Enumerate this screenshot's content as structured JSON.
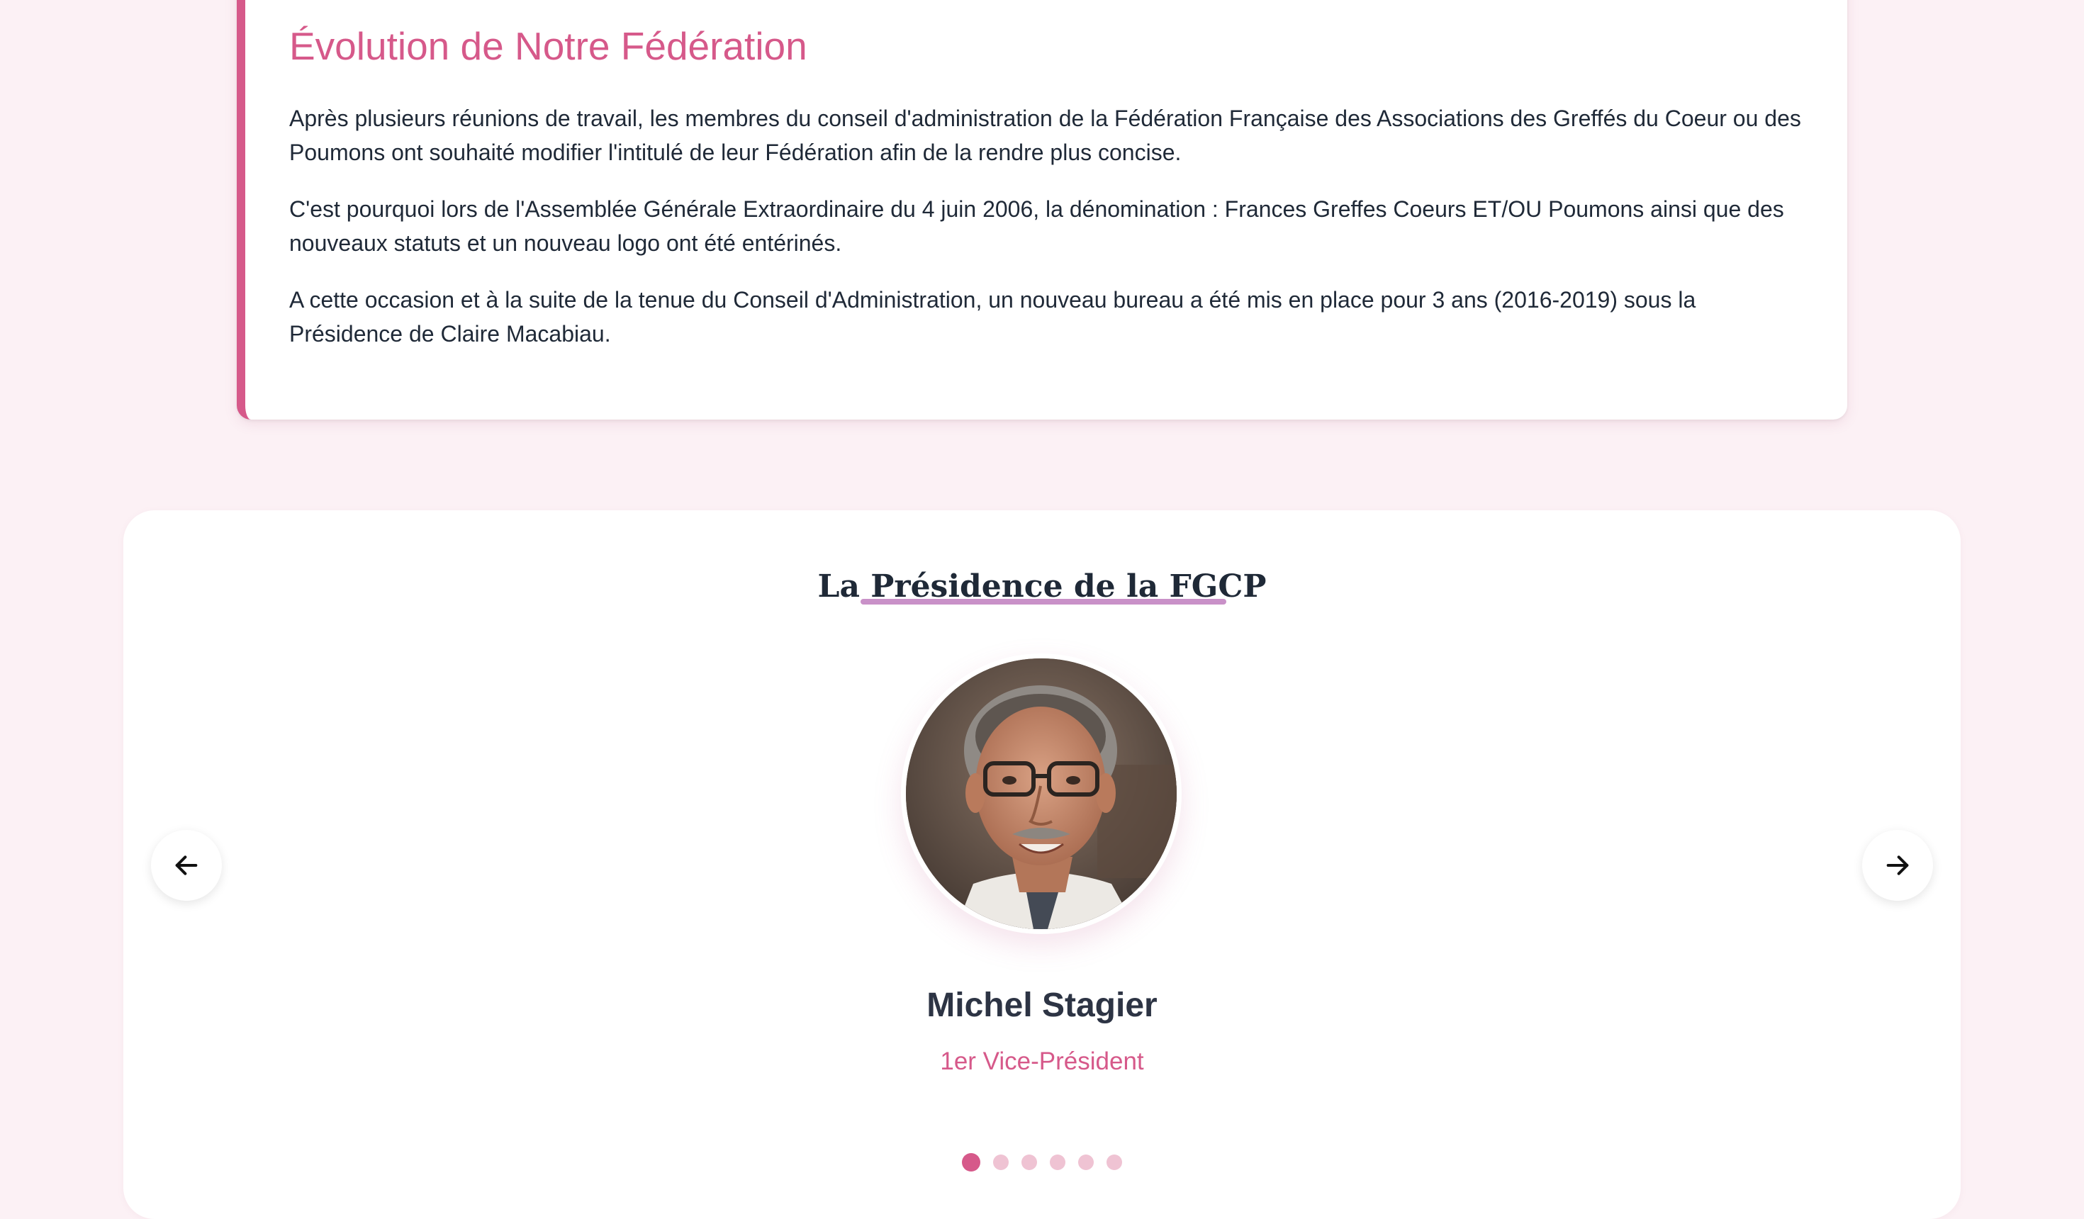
{
  "evolution": {
    "title": "Évolution de Notre Fédération",
    "paragraphs": [
      "Après plusieurs réunions de travail, les membres du conseil d'administration de la Fédération Française des Associations des Greffés du Coeur ou des Poumons ont souhaité modifier l'intitulé de leur Fédération afin de la rendre plus concise.",
      "C'est pourquoi lors de l'Assemblée Générale Extraordinaire du 4 juin 2006, la dénomination : Frances Greffes Coeurs ET/OU Poumons ainsi que des nouveaux statuts et un nouveau logo ont été entérinés.",
      "A cette occasion et à la suite de la tenue du Conseil d'Administration, un nouveau bureau a été mis en place pour 3 ans (2016-2019) sous la Présidence de Claire Macabiau."
    ]
  },
  "presidency": {
    "title": "La Présidence de la FGCP",
    "current_member": {
      "name": "Michel Stagier",
      "role": "1er Vice-Président"
    },
    "carousel": {
      "prev_icon": "arrow-left-icon",
      "next_icon": "arrow-right-icon",
      "slide_count": 6,
      "active_index": 0
    }
  },
  "colors": {
    "page_background": "#fcf1f5",
    "accent": "#d6598a",
    "underline": "#c991c8",
    "text": "#1f2937",
    "dot_inactive": "#efc3d3"
  }
}
